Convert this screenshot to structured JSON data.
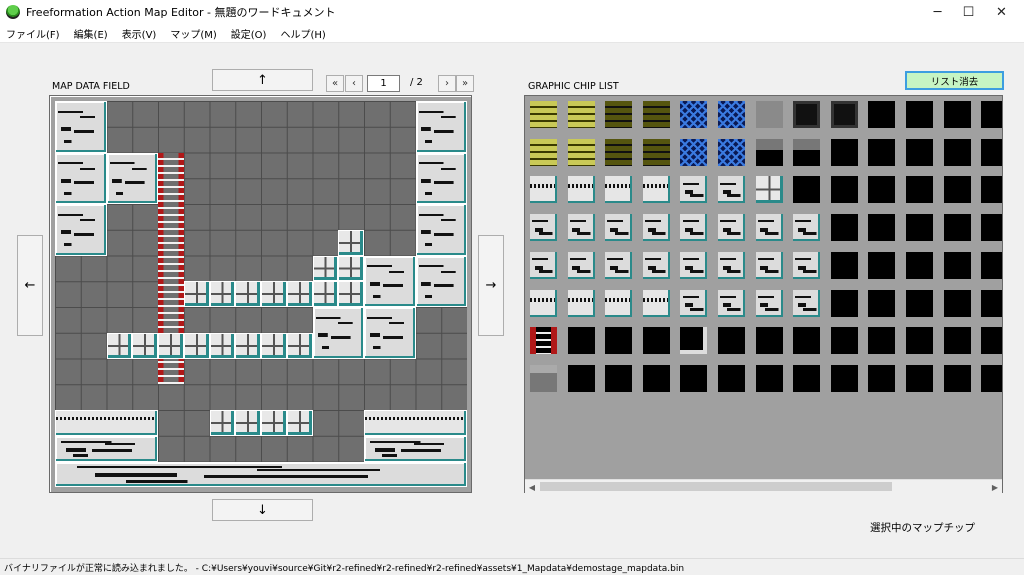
{
  "window": {
    "title": "Freeformation Action Map Editor - 無題のワードキュメント",
    "minimize": "─",
    "maximize": "☐",
    "close": "✕"
  },
  "menu": [
    "ファイル(F)",
    "編集(E)",
    "表示(V)",
    "マップ(M)",
    "設定(O)",
    "ヘルプ(H)"
  ],
  "map_field": {
    "label": "MAP DATA FIELD",
    "scroll_up": "↑",
    "scroll_down": "↓",
    "scroll_left": "←",
    "scroll_right": "→"
  },
  "pager": {
    "first": "«",
    "prev": "‹",
    "current": "1",
    "total": "/ 2",
    "next": "›",
    "last": "»"
  },
  "chip_list": {
    "label": "GRAPHIC CHIP LIST",
    "clear_button": "リスト消去",
    "selected_label": "選択中のマップチップ"
  },
  "scrollbar": {
    "left_arrow": "◀",
    "right_arrow": "▶"
  },
  "status": "バイナリファイルが正常に読み込まれました。 - C:¥Users¥youvi¥source¥Git¥r2-refined¥r2-refined¥r2-refined¥assets¥1_Mapdata¥demostage_mapdata.bin",
  "colors": {
    "accent_green": "#c6f5c3",
    "accent_blue_border": "#3d9ee0",
    "teal": "#2a8a8a",
    "ladder_red": "#b01818"
  }
}
